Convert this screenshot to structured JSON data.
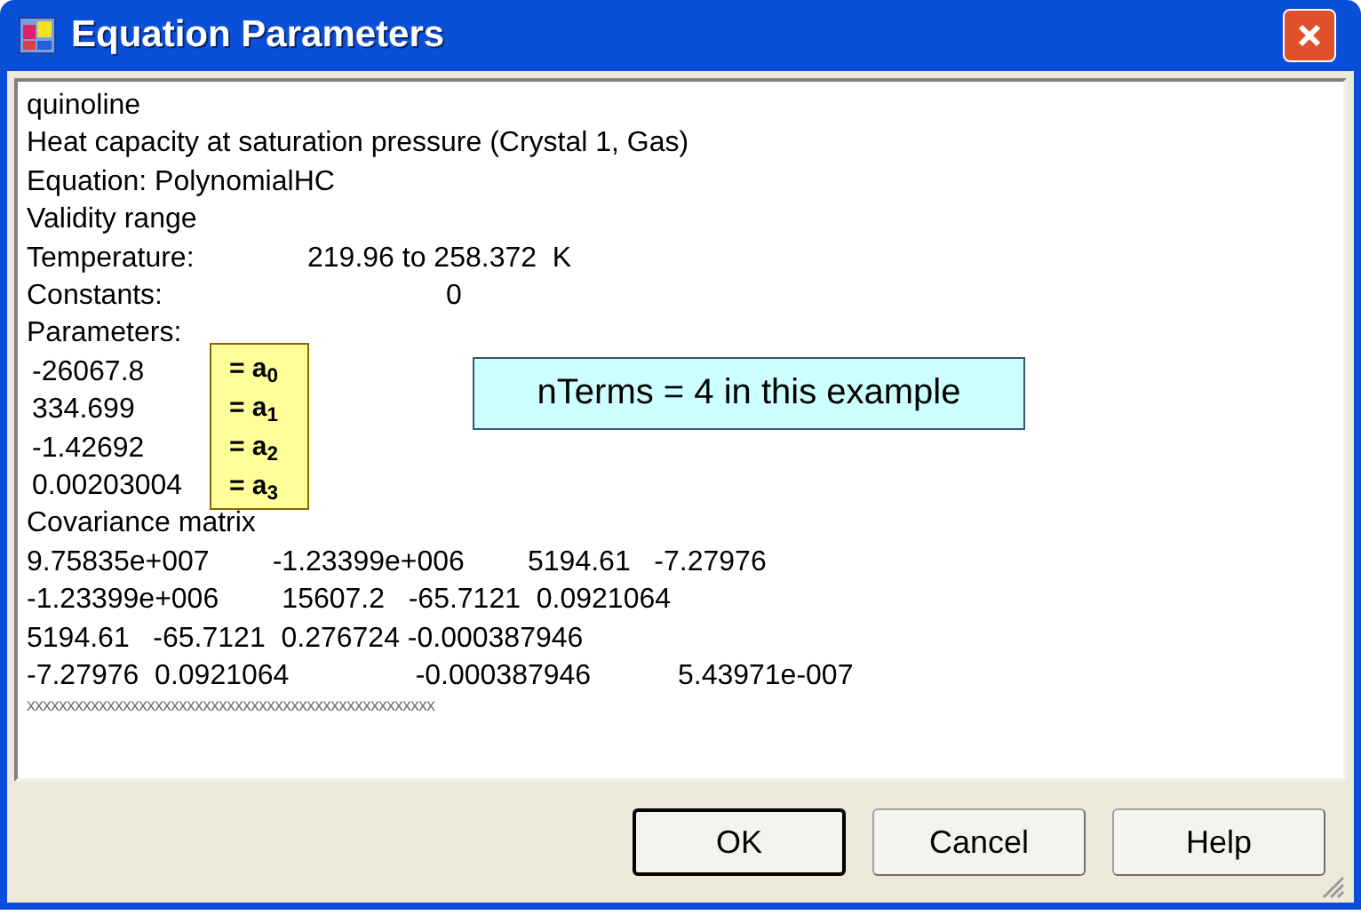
{
  "window": {
    "title": "Equation Parameters"
  },
  "report": {
    "lines": [
      {
        "kind": "text",
        "text": "quinoline"
      },
      {
        "kind": "text",
        "text": "Heat capacity at saturation pressure (Crystal 1, Gas)"
      },
      {
        "kind": "text",
        "text": "Equation: PolynomialHC"
      },
      {
        "kind": "text",
        "text": "Validity range"
      },
      {
        "kind": "field",
        "label": "Temperature:",
        "value": "219.96 to 258.372  K"
      },
      {
        "kind": "count",
        "label": "Constants:",
        "value": "0"
      },
      {
        "kind": "text",
        "text": "Parameters:"
      }
    ],
    "parameters": [
      "-26067.8",
      "334.699",
      "-1.42692",
      "0.00203004"
    ],
    "covariance_title": "Covariance matrix",
    "covariance_rows": [
      "9.75835e+007        -1.23399e+006        5194.61   -7.27976",
      "-1.23399e+006        15607.2   -65.7121  0.0921064",
      "5194.61   -65.7121  0.276724 -0.000387946",
      "-7.27976  0.0921064                -0.000387946           5.43971e-007"
    ],
    "separator": "xxxxxxxxxxxxxxxxxxxxxxxxxxxxxxxxxxxxxxxxxxxxxxxxxxx"
  },
  "annotations": {
    "coefficients": [
      "= a$_{0}$",
      "= a$_{1}$",
      "= a$_{2}$",
      "= a$_{3}$"
    ],
    "note": "nTerms = 4 in this example"
  },
  "buttons": [
    {
      "label": "OK",
      "default": true
    },
    {
      "label": "Cancel",
      "default": false
    },
    {
      "label": "Help",
      "default": false
    }
  ]
}
